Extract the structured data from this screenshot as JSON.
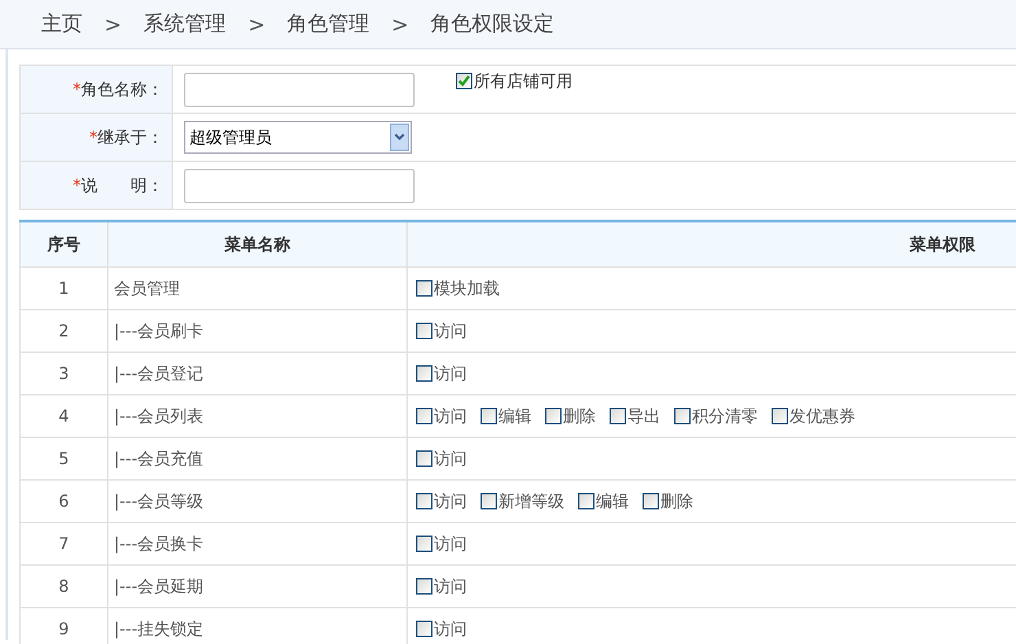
{
  "breadcrumb": [
    "主页",
    "系统管理",
    "角色管理",
    "角色权限设定"
  ],
  "breadcrumb_separator": ">",
  "form": {
    "rows": [
      {
        "kind": "text",
        "label": "角色名称：",
        "required": true,
        "value_option": {
          "label": "所有店铺可用",
          "checked": true
        }
      },
      {
        "kind": "select",
        "label": "继承于：",
        "required": true,
        "value": "超级管理员"
      },
      {
        "kind": "text",
        "label": "说　　明：",
        "required": true
      }
    ]
  },
  "required_mark": "*",
  "table": {
    "columns": [
      "序号",
      "菜单名称",
      "菜单权限"
    ],
    "rows": [
      {
        "index": "1",
        "name": "会员管理",
        "permissions": [
          {
            "label": "模块加载",
            "checked": false
          }
        ]
      },
      {
        "index": "2",
        "name": "|---会员刷卡",
        "permissions": [
          {
            "label": "访问",
            "checked": false
          }
        ]
      },
      {
        "index": "3",
        "name": "|---会员登记",
        "permissions": [
          {
            "label": "访问",
            "checked": false
          }
        ]
      },
      {
        "index": "4",
        "name": "|---会员列表",
        "permissions": [
          {
            "label": "访问",
            "checked": false
          },
          {
            "label": "编辑",
            "checked": false
          },
          {
            "label": "删除",
            "checked": false
          },
          {
            "label": "导出",
            "checked": false
          },
          {
            "label": "积分清零",
            "checked": false
          },
          {
            "label": "发优惠券",
            "checked": false
          }
        ]
      },
      {
        "index": "5",
        "name": "|---会员充值",
        "permissions": [
          {
            "label": "访问",
            "checked": false
          }
        ]
      },
      {
        "index": "6",
        "name": "|---会员等级",
        "permissions": [
          {
            "label": "访问",
            "checked": false
          },
          {
            "label": "新增等级",
            "checked": false
          },
          {
            "label": "编辑",
            "checked": false
          },
          {
            "label": "删除",
            "checked": false
          }
        ]
      },
      {
        "index": "7",
        "name": "|---会员换卡",
        "permissions": [
          {
            "label": "访问",
            "checked": false
          }
        ]
      },
      {
        "index": "8",
        "name": "|---会员延期",
        "permissions": [
          {
            "label": "访问",
            "checked": false
          }
        ]
      },
      {
        "index": "9",
        "name": "|---挂失锁定",
        "permissions": [
          {
            "label": "访问",
            "checked": false
          }
        ]
      }
    ]
  }
}
